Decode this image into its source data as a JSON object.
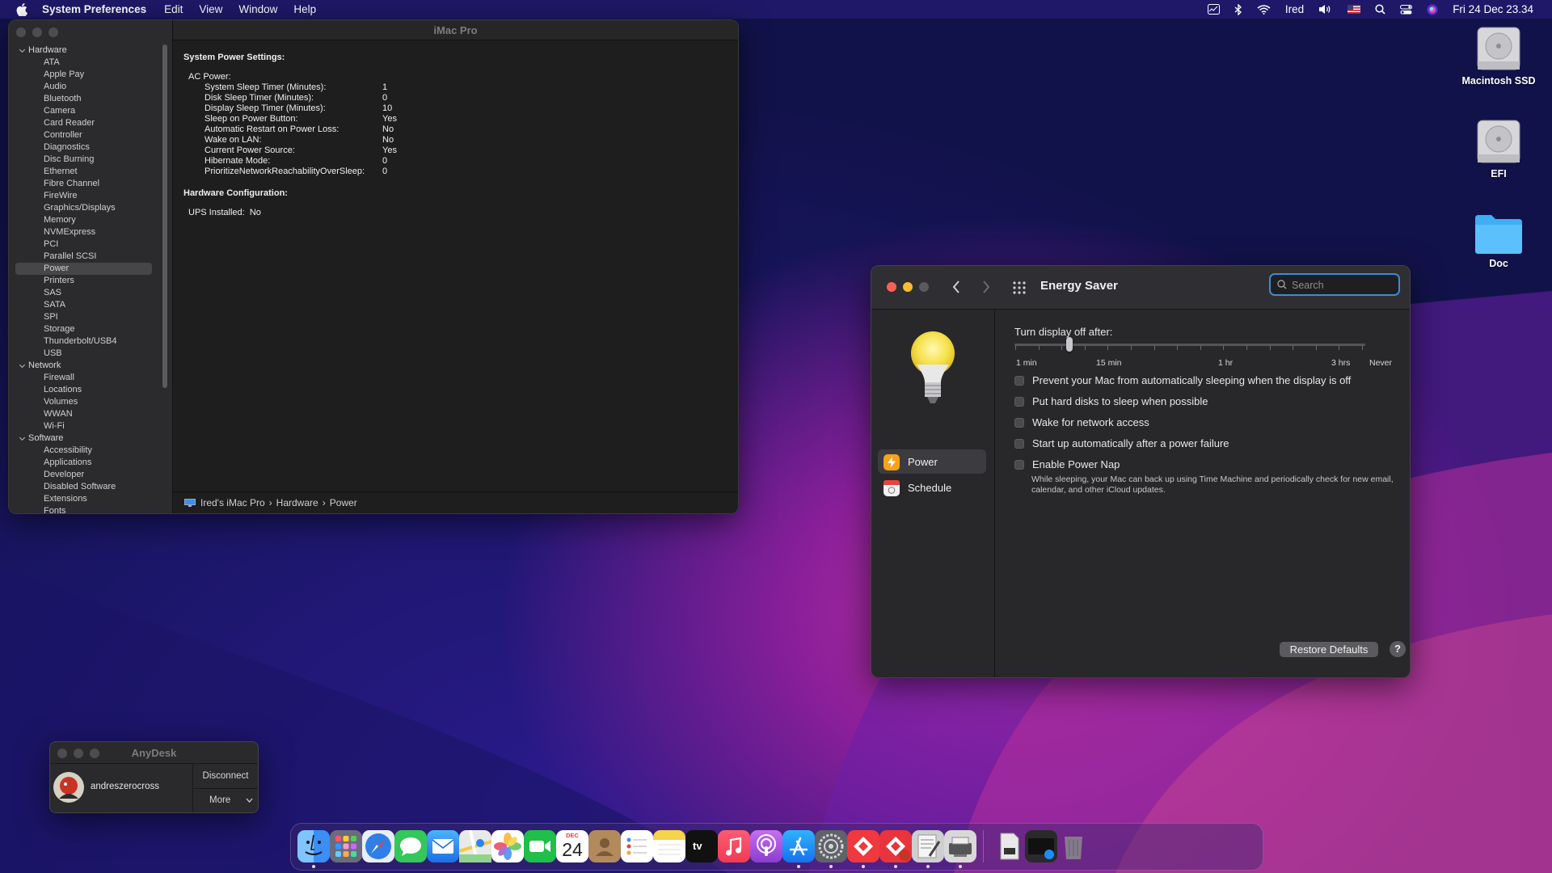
{
  "menubar": {
    "app": "System Preferences",
    "items": [
      "Edit",
      "View",
      "Window",
      "Help"
    ],
    "user": "Ired",
    "clock": "Fri 24 Dec  23.34"
  },
  "desktop": {
    "icons": [
      {
        "label": "Macintosh SSD"
      },
      {
        "label": "EFI"
      },
      {
        "label": "Doc"
      }
    ]
  },
  "sysinfo": {
    "title": "iMac Pro",
    "tree": {
      "hardware": "Hardware",
      "hardware_items": [
        "ATA",
        "Apple Pay",
        "Audio",
        "Bluetooth",
        "Camera",
        "Card Reader",
        "Controller",
        "Diagnostics",
        "Disc Burning",
        "Ethernet",
        "Fibre Channel",
        "FireWire",
        "Graphics/Displays",
        "Memory",
        "NVMExpress",
        "PCI",
        "Parallel SCSI",
        "Power",
        "Printers",
        "SAS",
        "SATA",
        "SPI",
        "Storage",
        "Thunderbolt/USB4",
        "USB"
      ],
      "network": "Network",
      "network_items": [
        "Firewall",
        "Locations",
        "Volumes",
        "WWAN",
        "Wi-Fi"
      ],
      "software": "Software",
      "software_items": [
        "Accessibility",
        "Applications",
        "Developer",
        "Disabled Software",
        "Extensions",
        "Fonts"
      ],
      "selected": "Power"
    },
    "report": {
      "heading1": "System Power Settings:",
      "ac_power": "AC Power:",
      "rows": [
        {
          "k": "System Sleep Timer (Minutes):",
          "v": "1"
        },
        {
          "k": "Disk Sleep Timer (Minutes):",
          "v": "0"
        },
        {
          "k": "Display Sleep Timer (Minutes):",
          "v": "10"
        },
        {
          "k": "Sleep on Power Button:",
          "v": "Yes"
        },
        {
          "k": "Automatic Restart on Power Loss:",
          "v": "No"
        },
        {
          "k": "Wake on LAN:",
          "v": "No"
        },
        {
          "k": "Current Power Source:",
          "v": "Yes"
        },
        {
          "k": "Hibernate Mode:",
          "v": "0"
        },
        {
          "k": "PrioritizeNetworkReachabilityOverSleep:",
          "v": "0"
        }
      ],
      "heading2": "Hardware Configuration:",
      "ups_label": "UPS Installed:",
      "ups_value": "No"
    },
    "breadcrumb": [
      "Ired's iMac Pro",
      "Hardware",
      "Power"
    ],
    "breadcrumb_sep": "›"
  },
  "energy": {
    "title": "Energy Saver",
    "search_placeholder": "Search",
    "sidebar": [
      "Power",
      "Schedule"
    ],
    "slider_label": "Turn display off after:",
    "slider_ticks": [
      "1 min",
      "15 min",
      "1 hr",
      "3 hrs",
      "Never"
    ],
    "slider_value": "15 min",
    "options": [
      "Prevent your Mac from automatically sleeping when the display is off",
      "Put hard disks to sleep when possible",
      "Wake for network access",
      "Start up automatically after a power failure",
      "Enable Power Nap"
    ],
    "power_nap_desc": "While sleeping, your Mac can back up using Time Machine and periodically check for new email, calendar, and other iCloud updates.",
    "restore": "Restore Defaults",
    "help": "?"
  },
  "anydesk": {
    "title": "AnyDesk",
    "user": "andreszerocross",
    "disconnect": "Disconnect",
    "more": "More"
  },
  "dock": {
    "calendar_month": "DEC",
    "calendar_day": "24",
    "tv_label": "tv",
    "colors": [
      "#3a8ef6",
      "#7d7d8f",
      "#2f7fe6",
      "#34c759",
      "#2a84f7",
      "#e9e9e9",
      "#f2c04a",
      "#1fbf4a",
      "#ffffff",
      "#b28a5c",
      "#f2f2f2",
      "#f5d34b",
      "#111111",
      "#f7435c",
      "#a54de0",
      "#1d8cf7",
      "#5f6268",
      "#f0383f",
      "#e8343d",
      "#cfcfcf",
      "#d8d8d8",
      "#e8e8e8",
      "#2a2a2a",
      "#8a8a8e"
    ]
  }
}
